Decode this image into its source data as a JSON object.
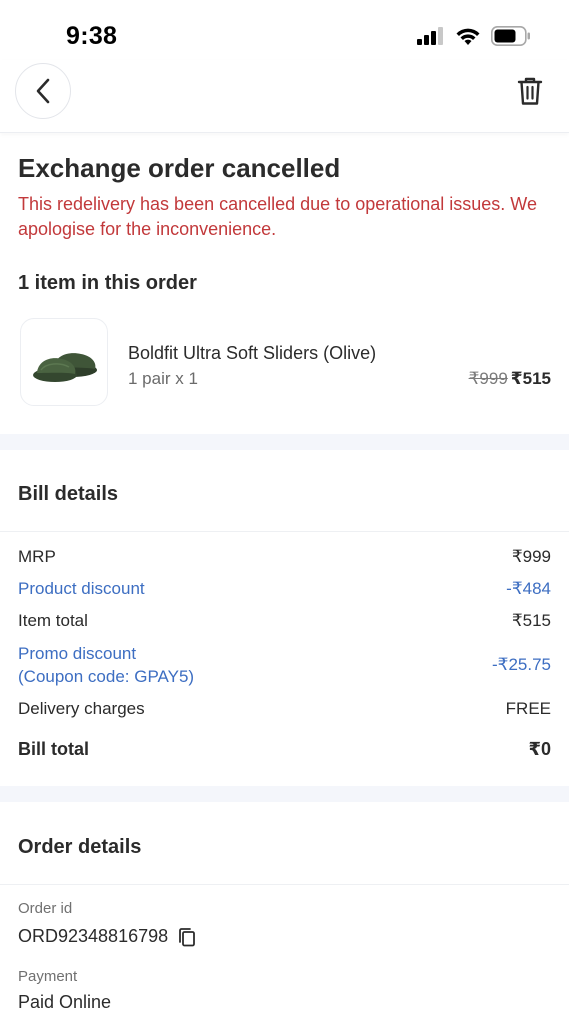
{
  "status_bar": {
    "time": "9:38"
  },
  "order": {
    "title": "Exchange order cancelled",
    "cancel_message": "This redelivery has been cancelled due to operational issues. We apologise for the inconvenience.",
    "items_heading": "1 item in this order",
    "item": {
      "name": "Boldfit Ultra Soft Sliders (Olive)",
      "quantity": "1 pair x 1",
      "mrp": "₹999",
      "price": "₹515"
    }
  },
  "bill": {
    "heading": "Bill details",
    "rows": [
      {
        "label": "MRP",
        "value": "₹999"
      },
      {
        "label": "Product discount",
        "value": "-₹484"
      },
      {
        "label": "Item total",
        "value": "₹515"
      },
      {
        "label": "Promo discount",
        "label2": "(Coupon code: GPAY5)",
        "value": "-₹25.75"
      },
      {
        "label": "Delivery charges",
        "value": "FREE"
      },
      {
        "label": "Bill total",
        "value": "₹0"
      }
    ],
    "discount_color": "#3d6ec2"
  },
  "order_details": {
    "heading": "Order details",
    "order_id_label": "Order id",
    "order_id": "ORD92348816798",
    "payment_label": "Payment",
    "payment": "Paid Online"
  },
  "icons": {
    "back": "chevron-left-icon",
    "delete": "trash-icon",
    "copy": "copy-icon"
  },
  "colors": {
    "alert_red": "#c2393b",
    "link_blue": "#3d6ec2",
    "band": "#f4f6fb"
  }
}
